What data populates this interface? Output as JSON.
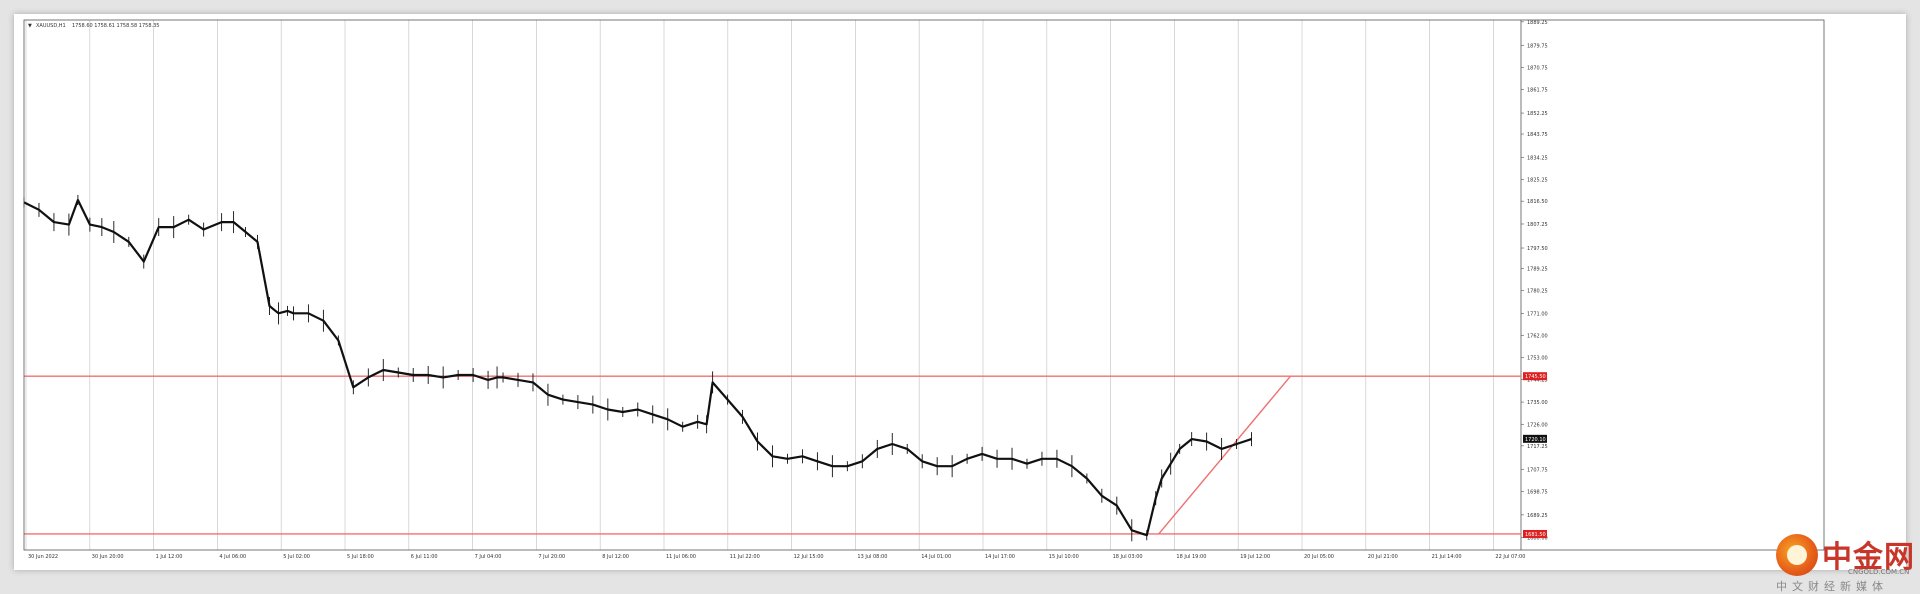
{
  "header": {
    "symbol_text": "XAUUSD,H1",
    "ohlc_text": "1758.60 1758.61 1758.58 1758.35"
  },
  "colors": {
    "background": "#ffffff",
    "grid": "#c8c8c8",
    "price_line": "#111111",
    "level_line": "#f07070",
    "trend_line": "#f07070",
    "badge_red": "#e02020",
    "badge_black": "#111111"
  },
  "chart_data": {
    "type": "line",
    "title": "",
    "xlabel": "",
    "ylabel": "",
    "ylim": [
      1675,
      1890
    ],
    "grid": true,
    "y_ticks": [
      1889.25,
      1879.75,
      1870.75,
      1861.75,
      1852.25,
      1843.75,
      1834.25,
      1825.25,
      1816.5,
      1807.25,
      1797.5,
      1789.25,
      1780.25,
      1771.0,
      1762.0,
      1753.0,
      1744.25,
      1735.0,
      1726.0,
      1717.25,
      1707.75,
      1698.75,
      1689.25,
      1680.0
    ],
    "x_labels": [
      "30 Jun 2022",
      "30 Jun 20:00",
      "1 Jul 12:00",
      "4 Jul 06:00",
      "5 Jul 02:00",
      "5 Jul 18:00",
      "6 Jul 11:00",
      "7 Jul 04:00",
      "7 Jul 20:00",
      "8 Jul 12:00",
      "11 Jul 06:00",
      "11 Jul 22:00",
      "12 Jul 15:00",
      "13 Jul 08:00",
      "14 Jul 01:00",
      "14 Jul 17:00",
      "15 Jul 10:00",
      "18 Jul 03:00",
      "18 Jul 19:00",
      "19 Jul 12:00",
      "20 Jul 05:00",
      "20 Jul 21:00",
      "21 Jul 14:00",
      "22 Jul 07:00"
    ],
    "series": [
      {
        "x_index": [
          0,
          5,
          10,
          15,
          18,
          22,
          26,
          30,
          35,
          40,
          45,
          50,
          55,
          60,
          66,
          70,
          74,
          78,
          82,
          85,
          88,
          90,
          95,
          100,
          105,
          110,
          115,
          120,
          125,
          130,
          135,
          140,
          145,
          150,
          155,
          158,
          160,
          165,
          170,
          175,
          180,
          185,
          190,
          195,
          200,
          205,
          210,
          215,
          220,
          225,
          228,
          230,
          235,
          240,
          245,
          250,
          255,
          260,
          265,
          270,
          275,
          280,
          285,
          290,
          295,
          300,
          305,
          310,
          315,
          320,
          325,
          330,
          335,
          340,
          345,
          350,
          355,
          360,
          365,
          370,
          375,
          378,
          380,
          383,
          386,
          390,
          395,
          400,
          405,
          410
        ],
        "values": [
          1816,
          1813,
          1808,
          1807,
          1817,
          1807,
          1806,
          1804,
          1800,
          1792,
          1806,
          1806,
          1809,
          1805,
          1808,
          1808,
          1804,
          1800,
          1774,
          1771,
          1772,
          1771,
          1771,
          1768,
          1760,
          1741,
          1745,
          1748,
          1747,
          1746,
          1746,
          1745,
          1746,
          1746,
          1744,
          1745,
          1745,
          1744,
          1743,
          1738,
          1736,
          1735,
          1734,
          1732,
          1731,
          1732,
          1730,
          1728,
          1725,
          1727,
          1726,
          1743,
          1736,
          1729,
          1719,
          1713,
          1712,
          1713,
          1711,
          1709,
          1709,
          1711,
          1716,
          1718,
          1716,
          1711,
          1709,
          1709,
          1712,
          1714,
          1712,
          1712,
          1710,
          1712,
          1712,
          1709,
          1704,
          1697,
          1693,
          1683,
          1681,
          1696,
          1704,
          1710,
          1716,
          1720,
          1719,
          1716,
          1718,
          1720
        ]
      }
    ],
    "x_count": 410,
    "levels": [
      {
        "value": 1745.5,
        "label": "1745.50"
      },
      {
        "value": 1681.5,
        "label": "1681.50"
      }
    ],
    "current_price": {
      "value": 1720.1,
      "label": "1720.10"
    },
    "trendline": {
      "from": {
        "x_index": 379,
        "value": 1681.5
      },
      "to": {
        "x_index": 423,
        "value": 1745.5
      }
    },
    "future_x_count": 90
  },
  "logo": {
    "name": "中金网",
    "url": "CNGOLD.COM.CN",
    "tagline": "中文财经新媒体"
  }
}
